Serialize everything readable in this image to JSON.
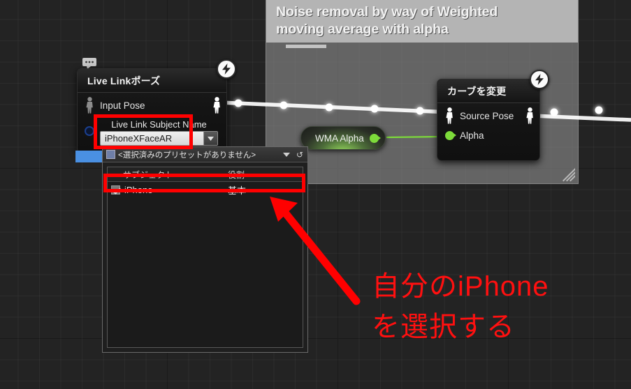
{
  "canvas": {
    "background_color": "#232323",
    "grid_color": "#2e2e2e"
  },
  "comment": {
    "title": "Noise removal by way of Weighted\nmoving average with alpha",
    "header_color": "#b4b4b4",
    "body_color": "#8c8c8c"
  },
  "nodes": [
    {
      "id": "live-link-pose",
      "title": "Live Linkポーズ",
      "input_pin_label": "Input Pose",
      "subject": {
        "label": "Live Link Subject Name",
        "value": "iPhoneXFaceAR",
        "arrow": "▼"
      },
      "badge_icon": "lightning-bolt-icon"
    },
    {
      "id": "modify-curve",
      "title": "カーブを変更",
      "pose_pin_label": "Source Pose",
      "alpha_pin_label": "Alpha",
      "alpha_color": "#7ddb3a",
      "badge_icon": "lightning-bolt-icon"
    }
  ],
  "pill_node": {
    "label": "WMA Alpha",
    "pin_color": "#7ddb3a"
  },
  "popup": {
    "preset_text": "<選択済みのプリセットがありません>",
    "caret": "▼",
    "reset_glyph": "↺",
    "columns": [
      "サブジェクト",
      "役割"
    ],
    "rows": [
      {
        "checked": true,
        "subject": "iPhone",
        "role": "基本"
      }
    ]
  },
  "annotation": {
    "text": "自分のiPhone\nを選択する",
    "color": "#ff1010",
    "highlight_color": "#ff0000",
    "arrow_name": "red-pointer-arrow"
  }
}
